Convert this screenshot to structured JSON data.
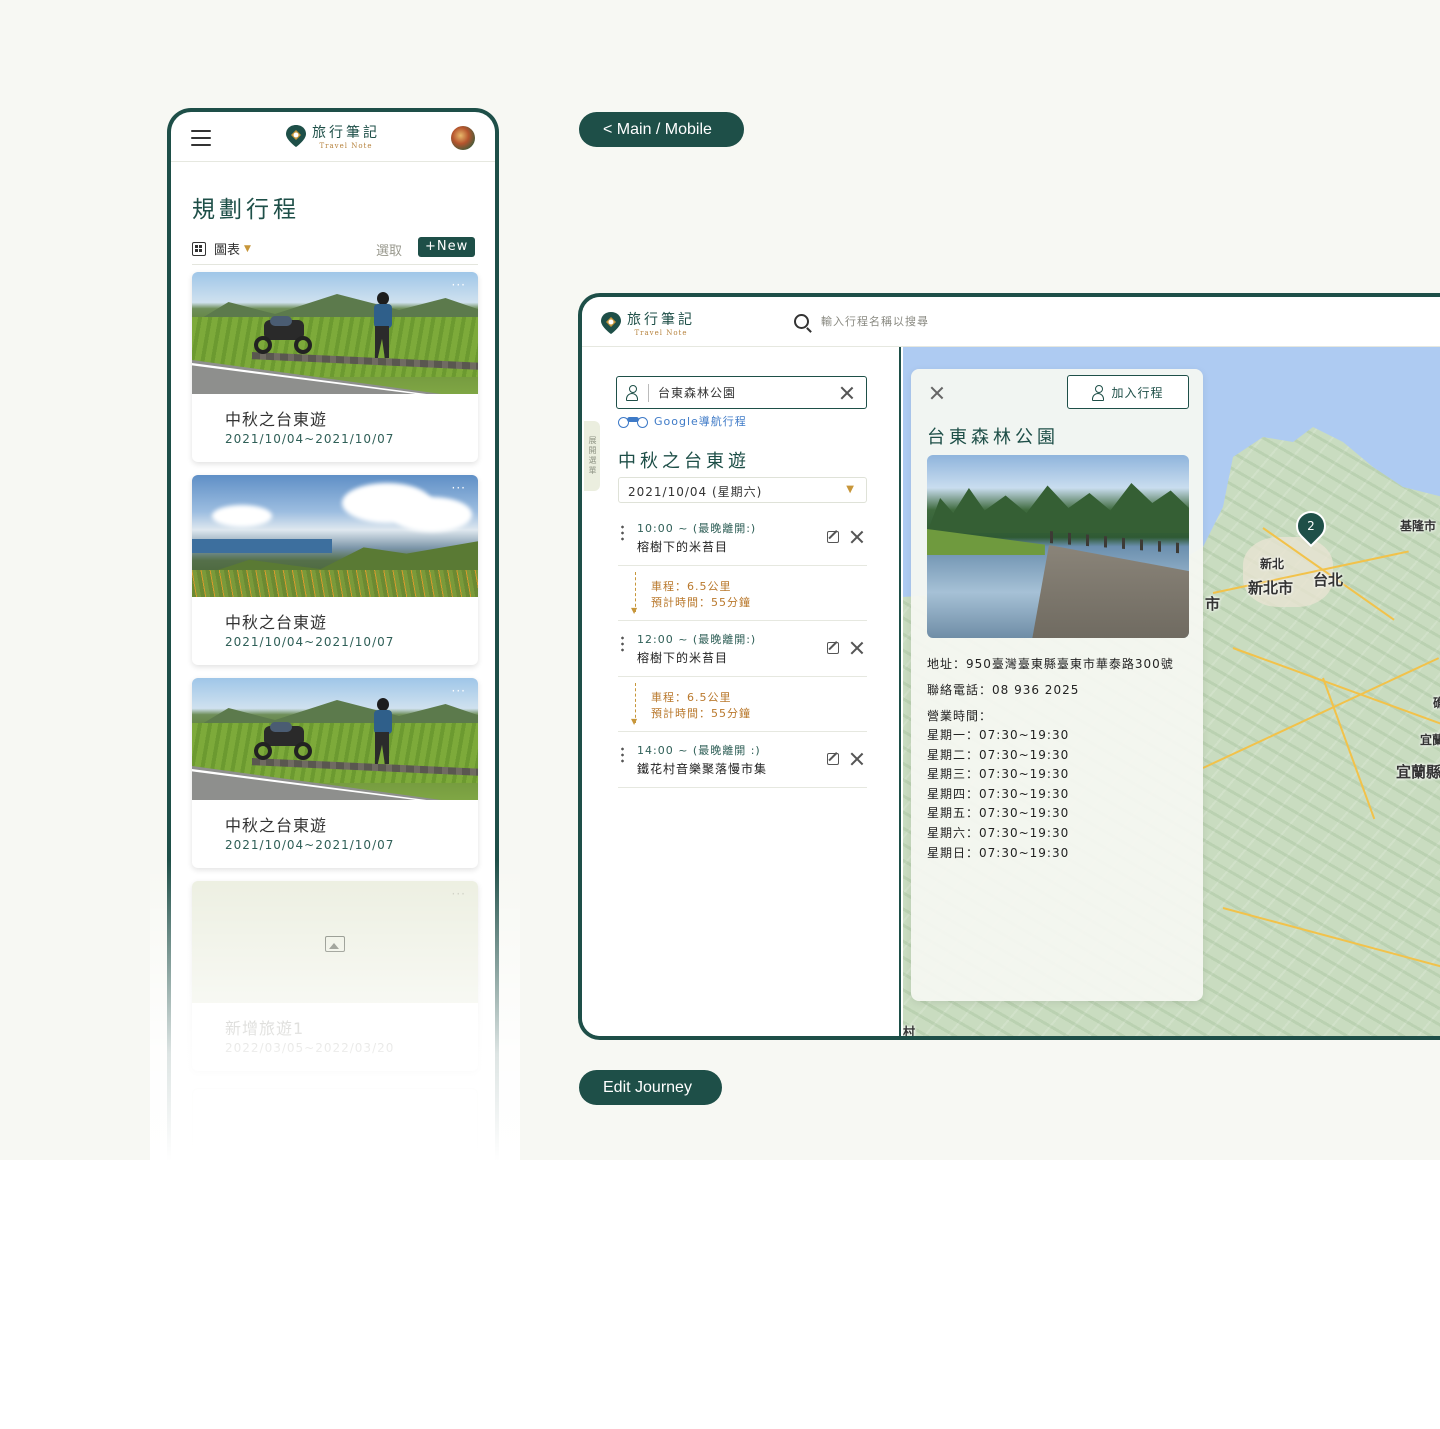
{
  "labels": {
    "main_mobile": "< Main / Mobile",
    "edit_journey": "Edit Journey"
  },
  "logo": {
    "cn": "旅行筆記",
    "en": "Travel Note"
  },
  "mobile": {
    "title": "規劃行程",
    "view_label": "圖表",
    "select_label": "選取",
    "new_button": "+New",
    "cards": [
      {
        "title": "中秋之台東遊",
        "dates": "2021/10/04~2021/10/07",
        "more": "···"
      },
      {
        "title": "中秋之台東遊",
        "dates": "2021/10/04~2021/10/07",
        "more": "···"
      },
      {
        "title": "中秋之台東遊",
        "dates": "2021/10/04~2021/10/07",
        "more": "···"
      },
      {
        "title": "新增旅遊1",
        "dates": "2022/03/05~2022/03/20",
        "more": "···"
      }
    ],
    "new_card_label": "+New"
  },
  "desktop": {
    "search_placeholder": "輸入行程名稱以搜尋",
    "side_tab": "展開選單",
    "place_input_value": "台東森林公園",
    "google_nav": "Google導航行程",
    "trip_title": "中秋之台東遊",
    "date_selected": "2021/10/04 (星期六)",
    "stops": [
      {
        "time": "10:00 ~ (最晚離開:)",
        "name": "榕樹下的米苔目"
      },
      {
        "time": "12:00 ~ (最晚離開:)",
        "name": "榕樹下的米苔目"
      },
      {
        "time": "14:00 ~ (最晚離開 :)",
        "name": "鐵花村音樂聚落慢市集"
      }
    ],
    "travels": [
      {
        "distance": "車程：6.5公里",
        "duration": "預計時間：55分鐘"
      },
      {
        "distance": "車程：6.5公里",
        "duration": "預計時間：55分鐘"
      }
    ],
    "detail": {
      "add_button": "加入行程",
      "title": "台東森林公園",
      "address": "地址：950臺灣臺東縣臺東市華泰路300號",
      "phone": "聯絡電話：08 936 2025",
      "hours_label": "營業時間：",
      "hours": [
        "星期一：07:30~19:30",
        "星期二：07:30~19:30",
        "星期三：07:30~19:30",
        "星期四：07:30~19:30",
        "星期五：07:30~19:30",
        "星期六：07:30~19:30",
        "星期日：07:30~19:30"
      ]
    },
    "map": {
      "pin_count": "2",
      "labels": [
        "基隆市",
        "新北",
        "新北市",
        "台北",
        "市",
        "宜蘭",
        "宜蘭縣",
        "礁",
        "村"
      ]
    }
  },
  "colors": {
    "primary": "#1e4f48",
    "accent": "#c7963a",
    "background": "#f7f8f3",
    "link": "#3e7ac7"
  }
}
